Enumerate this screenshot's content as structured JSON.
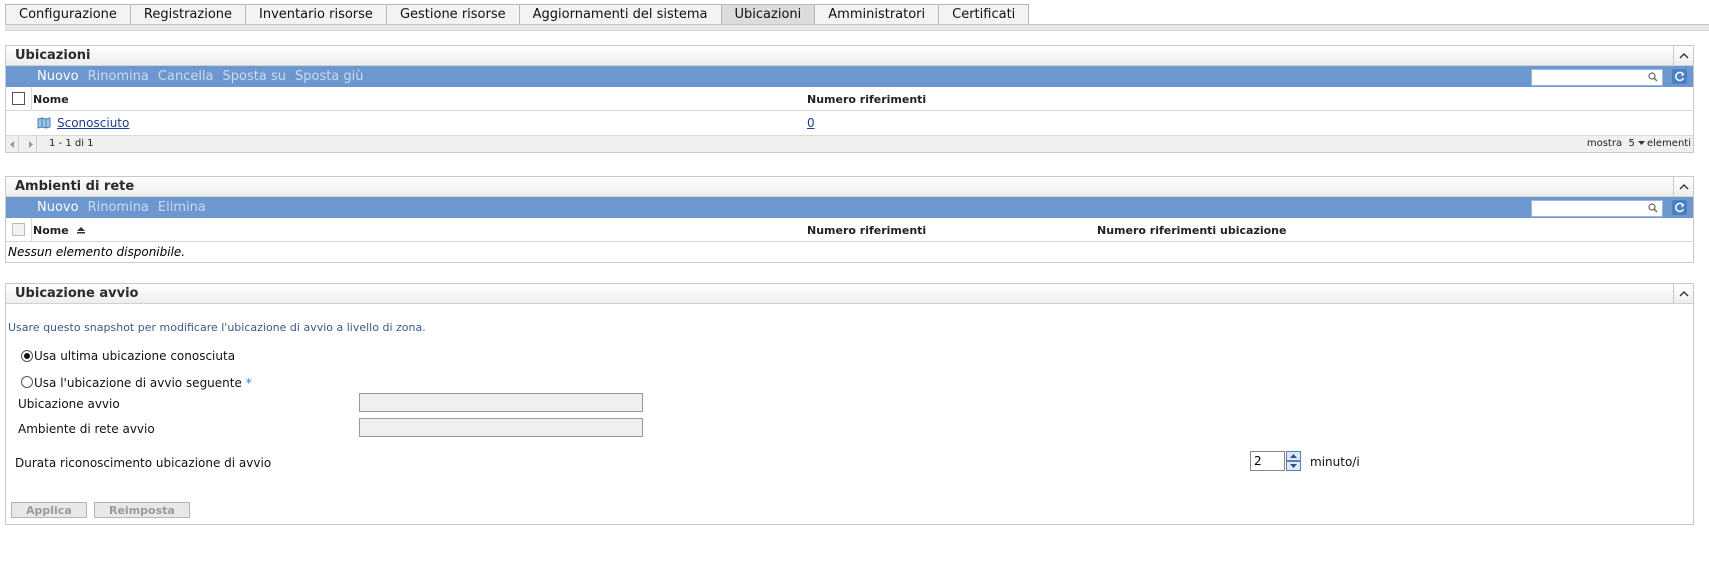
{
  "tabs": [
    "Configurazione",
    "Registrazione",
    "Inventario risorse",
    "Gestione risorse",
    "Aggiornamenti del sistema",
    "Ubicazioni",
    "Amministratori",
    "Certificati"
  ],
  "locations": {
    "title": "Ubicazioni",
    "toolbar": {
      "new": "Nuovo",
      "rename": "Rinomina",
      "delete": "Cancella",
      "move_up": "Sposta su",
      "move_down": "Sposta giù"
    },
    "columns": {
      "name": "Nome",
      "refs": "Numero riferimenti"
    },
    "rows": [
      {
        "name": "Sconosciuto",
        "refs": "0"
      }
    ],
    "pager": {
      "range": "1 - 1 di 1",
      "show_label": "mostra",
      "page_size": "5",
      "items_label": "elementi"
    }
  },
  "network_envs": {
    "title": "Ambienti di rete",
    "toolbar": {
      "new": "Nuovo",
      "rename": "Rinomina",
      "delete": "Elimina"
    },
    "columns": {
      "name": "Nome",
      "refs": "Numero riferimenti",
      "loc_refs": "Numero riferimenti ubicazione"
    },
    "empty_text": "Nessun elemento disponibile."
  },
  "startup": {
    "title": "Ubicazione avvio",
    "description": "Usare questo snapshot per modificare l'ubicazione di avvio a livello di zona.",
    "radio_last": "Usa ultima ubicazione conosciuta",
    "radio_following": "Usa l'ubicazione di avvio seguente",
    "required_mark": "*",
    "startup_location_label": "Ubicazione avvio",
    "startup_location_value": "",
    "startup_network_label": "Ambiente di rete avvio",
    "startup_network_value": "",
    "duration_label": "Durata riconoscimento ubicazione di avvio",
    "duration_value": "2",
    "duration_unit": "minuto/i",
    "apply": "Applica",
    "reset": "Reimposta"
  },
  "colors": {
    "toolbar_bg": "#6d98cf",
    "link": "#1b3f8e",
    "description": "#3a5a8a"
  }
}
